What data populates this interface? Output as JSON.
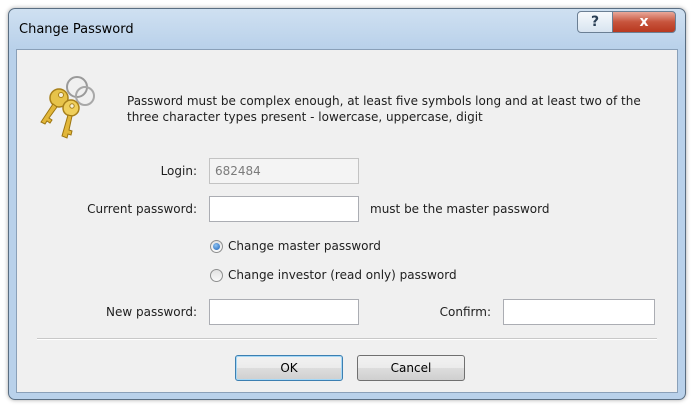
{
  "window": {
    "title": "Change Password",
    "help_glyph": "?",
    "close_glyph": "x"
  },
  "icon": "keys-icon",
  "description": "Password must be complex enough, at least five symbols long and at least two of the three character types present - lowercase, uppercase, digit",
  "form": {
    "login_label": "Login:",
    "login_value": "682484",
    "current_password_label": "Current password:",
    "current_password_value": "",
    "current_password_hint": "must be the master password",
    "radio_master_label": "Change master password",
    "radio_master_checked": true,
    "radio_investor_label": "Change investor (read only) password",
    "radio_investor_checked": false,
    "new_password_label": "New password:",
    "new_password_value": "",
    "confirm_label": "Confirm:",
    "confirm_value": ""
  },
  "buttons": {
    "ok_label": "OK",
    "cancel_label": "Cancel"
  }
}
